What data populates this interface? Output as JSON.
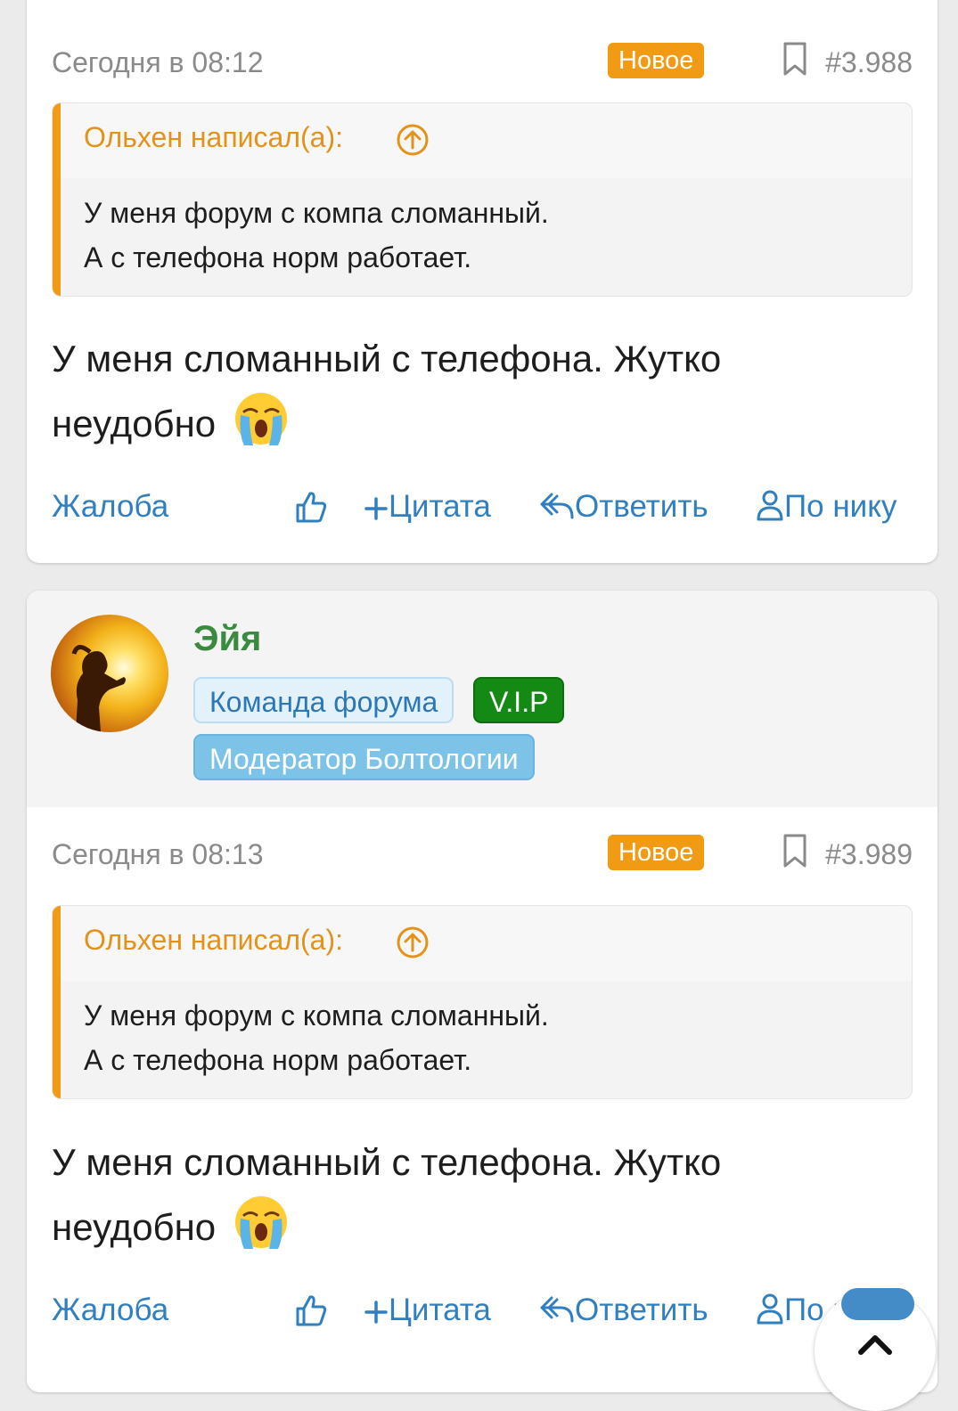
{
  "colors": {
    "accent": "#2f7fc1",
    "new_badge": "#f19a14",
    "quote_author": "#e3921a",
    "username": "#3a8a3f",
    "vip": "#148a14"
  },
  "posts": [
    {
      "time": "Сегодня в 08:12",
      "badge": "Новое",
      "number": "#3.988",
      "quote": {
        "author": "Ольхен написал(а):",
        "lines": [
          "У меня форум с компа сломанный.",
          "А с телефона норм работает."
        ]
      },
      "message_line1": "У меня сломанный с телефона. Жутко",
      "message_line2": "неудобно",
      "emoji": "loudly-crying-face-icon",
      "actions": {
        "report": "Жалоба",
        "quote": "Цитата",
        "reply": "Ответить",
        "by_nick": "По нику"
      }
    },
    {
      "user": {
        "name": "Эйя",
        "tags": [
          "Команда форума",
          "V.I.P",
          "Модератор Болтологии"
        ]
      },
      "time": "Сегодня в 08:13",
      "badge": "Новое",
      "number": "#3.989",
      "quote": {
        "author": "Ольхен написал(а):",
        "lines": [
          "У меня форум с компа сломанный.",
          "А с телефона норм работает."
        ]
      },
      "message_line1": "У меня сломанный с телефона. Жутко",
      "message_line2": "неудобно",
      "emoji": "loudly-crying-face-icon",
      "actions": {
        "report": "Жалоба",
        "quote": "Цитата",
        "reply": "Ответить",
        "by_nick": "По нику"
      }
    }
  ]
}
